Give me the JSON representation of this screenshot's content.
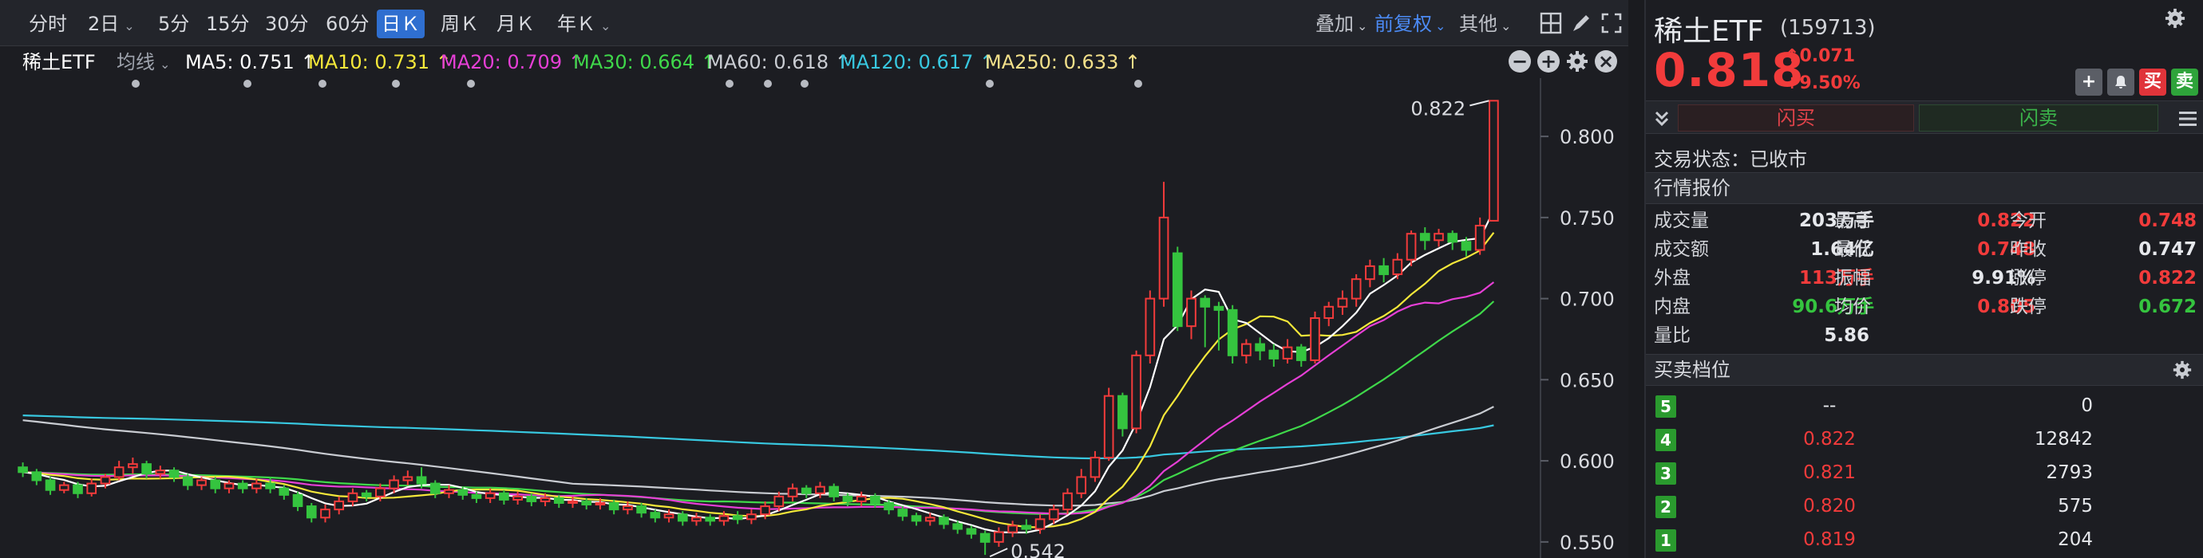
{
  "toolbar": {
    "timeframes": [
      "分时",
      "2日",
      "5分",
      "15分",
      "30分",
      "60分",
      "日Ｋ",
      "周Ｋ",
      "月Ｋ",
      "年Ｋ"
    ],
    "active_timeframe": "日Ｋ",
    "overlay_label": "叠加",
    "adjust_label": "前复权",
    "other_label": "其他"
  },
  "legend": {
    "name": "稀土ETF",
    "indicator": "均线",
    "items": [
      {
        "text": "MA5: 0.751 ↑",
        "color": "#ffffff"
      },
      {
        "text": "MA10: 0.731 ↑",
        "color": "#f5e83a"
      },
      {
        "text": "MA20: 0.709 ↑",
        "color": "#e63fd6"
      },
      {
        "text": "MA30: 0.664 ↑",
        "color": "#3fd84a"
      },
      {
        "text": "MA60: 0.618 ↑",
        "color": "#c9ccd2"
      },
      {
        "text": "MA120: 0.617 ↑",
        "color": "#38c8e0"
      },
      {
        "text": "MA250: 0.633 ↑",
        "color": "#f3e08a"
      }
    ]
  },
  "chart_data": {
    "type": "candlestick",
    "y_ticks": [
      "0.800",
      "0.750",
      "0.700",
      "0.650",
      "0.600",
      "0.550"
    ],
    "ylim": [
      0.545,
      0.832
    ],
    "high_marker": "0.822",
    "low_marker": "0.542",
    "candles": [
      [
        0.596,
        0.593,
        0.599,
        0.59
      ],
      [
        0.593,
        0.588,
        0.595,
        0.585
      ],
      [
        0.588,
        0.582,
        0.59,
        0.579
      ],
      [
        0.582,
        0.585,
        0.587,
        0.58
      ],
      [
        0.585,
        0.58,
        0.587,
        0.577
      ],
      [
        0.58,
        0.586,
        0.589,
        0.578
      ],
      [
        0.586,
        0.59,
        0.592,
        0.583
      ],
      [
        0.59,
        0.596,
        0.6,
        0.588
      ],
      [
        0.596,
        0.598,
        0.602,
        0.592
      ],
      [
        0.598,
        0.592,
        0.6,
        0.589
      ],
      [
        0.592,
        0.594,
        0.597,
        0.589
      ],
      [
        0.594,
        0.59,
        0.596,
        0.587
      ],
      [
        0.59,
        0.585,
        0.592,
        0.582
      ],
      [
        0.585,
        0.588,
        0.59,
        0.582
      ],
      [
        0.588,
        0.583,
        0.59,
        0.58
      ],
      [
        0.583,
        0.586,
        0.588,
        0.58
      ],
      [
        0.586,
        0.583,
        0.588,
        0.58
      ],
      [
        0.583,
        0.586,
        0.589,
        0.58
      ],
      [
        0.586,
        0.583,
        0.59,
        0.58
      ],
      [
        0.583,
        0.579,
        0.585,
        0.576
      ],
      [
        0.579,
        0.572,
        0.581,
        0.569
      ],
      [
        0.572,
        0.565,
        0.574,
        0.562
      ],
      [
        0.565,
        0.57,
        0.573,
        0.562
      ],
      [
        0.57,
        0.575,
        0.578,
        0.567
      ],
      [
        0.575,
        0.58,
        0.583,
        0.572
      ],
      [
        0.58,
        0.578,
        0.582,
        0.575
      ],
      [
        0.578,
        0.583,
        0.586,
        0.575
      ],
      [
        0.583,
        0.588,
        0.591,
        0.58
      ],
      [
        0.588,
        0.59,
        0.594,
        0.585
      ],
      [
        0.59,
        0.586,
        0.596,
        0.583
      ],
      [
        0.586,
        0.58,
        0.588,
        0.577
      ],
      [
        0.58,
        0.582,
        0.585,
        0.577
      ],
      [
        0.582,
        0.579,
        0.584,
        0.576
      ],
      [
        0.579,
        0.577,
        0.581,
        0.574
      ],
      [
        0.577,
        0.58,
        0.583,
        0.574
      ],
      [
        0.58,
        0.576,
        0.582,
        0.573
      ],
      [
        0.576,
        0.578,
        0.581,
        0.573
      ],
      [
        0.578,
        0.575,
        0.58,
        0.572
      ],
      [
        0.575,
        0.577,
        0.58,
        0.572
      ],
      [
        0.577,
        0.574,
        0.579,
        0.571
      ],
      [
        0.574,
        0.575,
        0.578,
        0.571
      ],
      [
        0.575,
        0.573,
        0.577,
        0.57
      ],
      [
        0.573,
        0.574,
        0.577,
        0.57
      ],
      [
        0.574,
        0.57,
        0.576,
        0.567
      ],
      [
        0.57,
        0.572,
        0.575,
        0.567
      ],
      [
        0.572,
        0.568,
        0.574,
        0.565
      ],
      [
        0.568,
        0.565,
        0.57,
        0.562
      ],
      [
        0.565,
        0.567,
        0.57,
        0.562
      ],
      [
        0.567,
        0.563,
        0.569,
        0.56
      ],
      [
        0.563,
        0.565,
        0.568,
        0.56
      ],
      [
        0.565,
        0.563,
        0.567,
        0.56
      ],
      [
        0.563,
        0.566,
        0.569,
        0.56
      ],
      [
        0.566,
        0.564,
        0.569,
        0.561
      ],
      [
        0.564,
        0.567,
        0.57,
        0.561
      ],
      [
        0.567,
        0.572,
        0.575,
        0.564
      ],
      [
        0.572,
        0.578,
        0.581,
        0.569
      ],
      [
        0.578,
        0.583,
        0.586,
        0.575
      ],
      [
        0.583,
        0.58,
        0.585,
        0.577
      ],
      [
        0.58,
        0.584,
        0.587,
        0.577
      ],
      [
        0.584,
        0.578,
        0.586,
        0.575
      ],
      [
        0.578,
        0.575,
        0.58,
        0.572
      ],
      [
        0.575,
        0.578,
        0.581,
        0.572
      ],
      [
        0.578,
        0.574,
        0.58,
        0.571
      ],
      [
        0.574,
        0.57,
        0.576,
        0.567
      ],
      [
        0.57,
        0.566,
        0.572,
        0.563
      ],
      [
        0.566,
        0.563,
        0.568,
        0.56
      ],
      [
        0.563,
        0.565,
        0.568,
        0.56
      ],
      [
        0.565,
        0.561,
        0.567,
        0.558
      ],
      [
        0.561,
        0.558,
        0.563,
        0.555
      ],
      [
        0.558,
        0.555,
        0.56,
        0.552
      ],
      [
        0.555,
        0.55,
        0.557,
        0.542
      ],
      [
        0.55,
        0.556,
        0.559,
        0.547
      ],
      [
        0.556,
        0.56,
        0.563,
        0.553
      ],
      [
        0.56,
        0.558,
        0.564,
        0.555
      ],
      [
        0.558,
        0.564,
        0.567,
        0.555
      ],
      [
        0.564,
        0.57,
        0.573,
        0.561
      ],
      [
        0.57,
        0.58,
        0.583,
        0.567
      ],
      [
        0.58,
        0.59,
        0.595,
        0.577
      ],
      [
        0.59,
        0.602,
        0.606,
        0.587
      ],
      [
        0.602,
        0.64,
        0.645,
        0.6
      ],
      [
        0.64,
        0.62,
        0.642,
        0.615
      ],
      [
        0.62,
        0.665,
        0.668,
        0.617
      ],
      [
        0.665,
        0.7,
        0.705,
        0.66
      ],
      [
        0.7,
        0.75,
        0.772,
        0.695
      ],
      [
        0.728,
        0.683,
        0.732,
        0.68
      ],
      [
        0.683,
        0.7,
        0.705,
        0.675
      ],
      [
        0.7,
        0.695,
        0.702,
        0.67
      ],
      [
        0.695,
        0.693,
        0.698,
        0.668
      ],
      [
        0.693,
        0.665,
        0.696,
        0.66
      ],
      [
        0.665,
        0.672,
        0.675,
        0.66
      ],
      [
        0.672,
        0.668,
        0.676,
        0.662
      ],
      [
        0.668,
        0.663,
        0.672,
        0.658
      ],
      [
        0.663,
        0.67,
        0.675,
        0.66
      ],
      [
        0.67,
        0.662,
        0.672,
        0.658
      ],
      [
        0.662,
        0.688,
        0.692,
        0.66
      ],
      [
        0.688,
        0.695,
        0.698,
        0.683
      ],
      [
        0.695,
        0.7,
        0.705,
        0.69
      ],
      [
        0.7,
        0.712,
        0.715,
        0.695
      ],
      [
        0.712,
        0.72,
        0.724,
        0.707
      ],
      [
        0.72,
        0.715,
        0.725,
        0.71
      ],
      [
        0.715,
        0.724,
        0.728,
        0.712
      ],
      [
        0.724,
        0.74,
        0.742,
        0.72
      ],
      [
        0.74,
        0.736,
        0.744,
        0.73
      ],
      [
        0.736,
        0.74,
        0.743,
        0.732
      ],
      [
        0.74,
        0.735,
        0.742,
        0.73
      ],
      [
        0.735,
        0.73,
        0.738,
        0.726
      ],
      [
        0.73,
        0.745,
        0.75,
        0.727
      ],
      [
        0.748,
        0.822,
        0.822,
        0.748
      ]
    ]
  },
  "quote": {
    "name": "稀土ETF",
    "code": "(159713)",
    "price": "0.818",
    "change": "0.071",
    "change_arrow": "↑",
    "change_pct": "+9.50%",
    "flash_buy": "闪买",
    "flash_sell": "闪卖",
    "trade_status": "交易状态：已收市",
    "quotes_header": "行情报价",
    "stats": [
      {
        "l1": "成交量",
        "v1": "203万手",
        "c1": "white",
        "l2": "最高",
        "v2": "0.822",
        "c2": "red",
        "l3": "今开",
        "v3": "0.748",
        "c3": "red"
      },
      {
        "l1": "成交额",
        "v1": "1.64亿",
        "c1": "white",
        "l2": "最低",
        "v2": "0.748",
        "c2": "red",
        "l3": "昨收",
        "v3": "0.747",
        "c3": "white"
      },
      {
        "l1": "外盘",
        "v1": "113万手",
        "c1": "red",
        "l2": "振幅",
        "v2": "9.91%",
        "c2": "white",
        "l3": "涨停",
        "v3": "0.822",
        "c3": "red"
      },
      {
        "l1": "内盘",
        "v1": "90.6万手",
        "c1": "green",
        "l2": "均价",
        "v2": "0.805",
        "c2": "red",
        "l3": "跌停",
        "v3": "0.672",
        "c3": "green"
      }
    ],
    "volume_ratio_label": "量比",
    "volume_ratio": "5.86",
    "orderbook_header": "买卖档位",
    "orderbook": [
      {
        "level": "5",
        "price": "--",
        "volume": "0"
      },
      {
        "level": "4",
        "price": "0.822",
        "volume": "12842"
      },
      {
        "level": "3",
        "price": "0.821",
        "volume": "2793"
      },
      {
        "level": "2",
        "price": "0.820",
        "volume": "575"
      },
      {
        "level": "1",
        "price": "0.819",
        "volume": "204"
      }
    ],
    "buttons": [
      {
        "label": "+",
        "color": "#5b5e66"
      },
      {
        "label": "🔔",
        "color": "#5b5e66"
      },
      {
        "label": "买",
        "color": "#e0343a"
      },
      {
        "label": "卖",
        "color": "#2ea33a"
      }
    ]
  }
}
